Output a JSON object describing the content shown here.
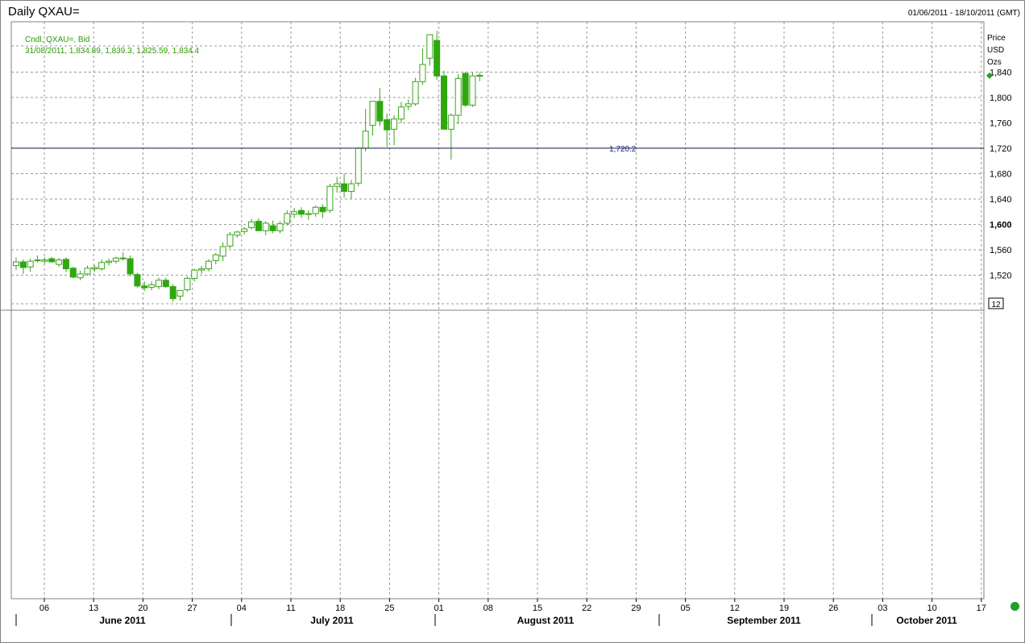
{
  "header": {
    "title": "Daily QXAU=",
    "date_range": "01/06/2011 - 18/10/2011 (GMT)"
  },
  "legend": {
    "line1": "Cndl, QXAU=, Bid",
    "line2": "31/08/2011, 1,834.89, 1,839.3, 1,825.59, 1,834.4"
  },
  "axis_unit": [
    "Price",
    "USD",
    "Ozs"
  ],
  "colors": {
    "up_candle_border": "#3aa31a",
    "down_candle_fill": "#2fa80f",
    "grid": "#9a9a9a",
    "reference_line": "#1a1a55",
    "reference_label": "#1a1a88"
  },
  "chart_data": {
    "type": "candlestick",
    "title": "Daily QXAU=",
    "ylabel": "Price USD Ozs",
    "ylim": [
      1495,
      1905
    ],
    "y_ticks": [
      "1,520",
      "1,560",
      "1,600",
      "1,640",
      "1,680",
      "1,720",
      "1,760",
      "1,800",
      "1,840"
    ],
    "y_tick_values": [
      1520,
      1560,
      1600,
      1640,
      1680,
      1720,
      1760,
      1800,
      1840
    ],
    "x_ticks": [
      "06",
      "13",
      "20",
      "27",
      "04",
      "11",
      "18",
      "25",
      "01",
      "08",
      "15",
      "22",
      "29",
      "05",
      "12",
      "19",
      "26",
      "03",
      "10",
      "17"
    ],
    "months": [
      "June 2011",
      "July 2011",
      "August 2011",
      "September 2011",
      "October 2011"
    ],
    "reference_line": {
      "value": 1720.2,
      "label": "1,720.2"
    },
    "last_price_marker": 1834.4,
    "sub_panel_label": "12",
    "candles": [
      {
        "date": "2011-06-01",
        "o": 1535,
        "h": 1548,
        "l": 1528,
        "c": 1541
      },
      {
        "date": "2011-06-02",
        "o": 1541,
        "h": 1545,
        "l": 1522,
        "c": 1532
      },
      {
        "date": "2011-06-03",
        "o": 1533,
        "h": 1546,
        "l": 1525,
        "c": 1542
      },
      {
        "date": "2011-06-06",
        "o": 1544,
        "h": 1551,
        "l": 1540,
        "c": 1543
      },
      {
        "date": "2011-06-07",
        "o": 1542,
        "h": 1548,
        "l": 1538,
        "c": 1544
      },
      {
        "date": "2011-06-08",
        "o": 1546,
        "h": 1549,
        "l": 1540,
        "c": 1541
      },
      {
        "date": "2011-06-09",
        "o": 1537,
        "h": 1547,
        "l": 1533,
        "c": 1544
      },
      {
        "date": "2011-06-10",
        "o": 1545,
        "h": 1548,
        "l": 1525,
        "c": 1530
      },
      {
        "date": "2011-06-13",
        "o": 1531,
        "h": 1533,
        "l": 1515,
        "c": 1517
      },
      {
        "date": "2011-06-14",
        "o": 1516,
        "h": 1527,
        "l": 1512,
        "c": 1522
      },
      {
        "date": "2011-06-15",
        "o": 1522,
        "h": 1535,
        "l": 1519,
        "c": 1531
      },
      {
        "date": "2011-06-16",
        "o": 1530,
        "h": 1536,
        "l": 1525,
        "c": 1532
      },
      {
        "date": "2011-06-17",
        "o": 1530,
        "h": 1545,
        "l": 1527,
        "c": 1540
      },
      {
        "date": "2011-06-20",
        "o": 1540,
        "h": 1546,
        "l": 1535,
        "c": 1542
      },
      {
        "date": "2011-06-21",
        "o": 1542,
        "h": 1549,
        "l": 1538,
        "c": 1547
      },
      {
        "date": "2011-06-22",
        "o": 1547,
        "h": 1556,
        "l": 1543,
        "c": 1547
      },
      {
        "date": "2011-06-23",
        "o": 1546,
        "h": 1551,
        "l": 1518,
        "c": 1522
      },
      {
        "date": "2011-06-24",
        "o": 1521,
        "h": 1524,
        "l": 1500,
        "c": 1503
      },
      {
        "date": "2011-06-27",
        "o": 1503,
        "h": 1510,
        "l": 1495,
        "c": 1500
      },
      {
        "date": "2011-06-28",
        "o": 1501,
        "h": 1510,
        "l": 1496,
        "c": 1505
      },
      {
        "date": "2011-06-29",
        "o": 1502,
        "h": 1516,
        "l": 1498,
        "c": 1512
      },
      {
        "date": "2011-06-30",
        "o": 1512,
        "h": 1516,
        "l": 1500,
        "c": 1502
      },
      {
        "date": "2011-07-01",
        "o": 1502,
        "h": 1506,
        "l": 1478,
        "c": 1483
      },
      {
        "date": "2011-07-04",
        "o": 1487,
        "h": 1496,
        "l": 1480,
        "c": 1496
      },
      {
        "date": "2011-07-05",
        "o": 1497,
        "h": 1518,
        "l": 1494,
        "c": 1515
      },
      {
        "date": "2011-07-06",
        "o": 1515,
        "h": 1530,
        "l": 1510,
        "c": 1528
      },
      {
        "date": "2011-07-07",
        "o": 1528,
        "h": 1535,
        "l": 1522,
        "c": 1530
      },
      {
        "date": "2011-07-08",
        "o": 1530,
        "h": 1545,
        "l": 1526,
        "c": 1542
      },
      {
        "date": "2011-07-11",
        "o": 1543,
        "h": 1555,
        "l": 1537,
        "c": 1552
      },
      {
        "date": "2011-07-12",
        "o": 1550,
        "h": 1572,
        "l": 1542,
        "c": 1565
      },
      {
        "date": "2011-07-13",
        "o": 1566,
        "h": 1588,
        "l": 1562,
        "c": 1584
      },
      {
        "date": "2011-07-14",
        "o": 1583,
        "h": 1590,
        "l": 1579,
        "c": 1588
      },
      {
        "date": "2011-07-15",
        "o": 1589,
        "h": 1596,
        "l": 1584,
        "c": 1593
      },
      {
        "date": "2011-07-18",
        "o": 1595,
        "h": 1609,
        "l": 1592,
        "c": 1604
      },
      {
        "date": "2011-07-19",
        "o": 1605,
        "h": 1610,
        "l": 1590,
        "c": 1590
      },
      {
        "date": "2011-07-20",
        "o": 1590,
        "h": 1605,
        "l": 1583,
        "c": 1602
      },
      {
        "date": "2011-07-21",
        "o": 1598,
        "h": 1606,
        "l": 1586,
        "c": 1590
      },
      {
        "date": "2011-07-22",
        "o": 1590,
        "h": 1605,
        "l": 1586,
        "c": 1601
      },
      {
        "date": "2011-07-25",
        "o": 1602,
        "h": 1622,
        "l": 1598,
        "c": 1617
      },
      {
        "date": "2011-07-26",
        "o": 1616,
        "h": 1626,
        "l": 1610,
        "c": 1620
      },
      {
        "date": "2011-07-27",
        "o": 1622,
        "h": 1627,
        "l": 1610,
        "c": 1616
      },
      {
        "date": "2011-07-28",
        "o": 1616,
        "h": 1622,
        "l": 1607,
        "c": 1617
      },
      {
        "date": "2011-07-29",
        "o": 1617,
        "h": 1630,
        "l": 1612,
        "c": 1627
      },
      {
        "date": "2011-08-01",
        "o": 1627,
        "h": 1632,
        "l": 1610,
        "c": 1620
      },
      {
        "date": "2011-08-02",
        "o": 1622,
        "h": 1664,
        "l": 1618,
        "c": 1660
      },
      {
        "date": "2011-08-03",
        "o": 1660,
        "h": 1675,
        "l": 1650,
        "c": 1664
      },
      {
        "date": "2011-08-04",
        "o": 1664,
        "h": 1680,
        "l": 1642,
        "c": 1652
      },
      {
        "date": "2011-08-05",
        "o": 1652,
        "h": 1670,
        "l": 1640,
        "c": 1664
      },
      {
        "date": "2011-08-08",
        "o": 1665,
        "h": 1722,
        "l": 1660,
        "c": 1720
      },
      {
        "date": "2011-08-09",
        "o": 1720,
        "h": 1782,
        "l": 1715,
        "c": 1747
      },
      {
        "date": "2011-08-10",
        "o": 1756,
        "h": 1794,
        "l": 1740,
        "c": 1794
      },
      {
        "date": "2011-08-11",
        "o": 1794,
        "h": 1815,
        "l": 1755,
        "c": 1763
      },
      {
        "date": "2011-08-12",
        "o": 1765,
        "h": 1775,
        "l": 1722,
        "c": 1749
      },
      {
        "date": "2011-08-15",
        "o": 1750,
        "h": 1772,
        "l": 1725,
        "c": 1766
      },
      {
        "date": "2011-08-16",
        "o": 1766,
        "h": 1793,
        "l": 1760,
        "c": 1785
      },
      {
        "date": "2011-08-17",
        "o": 1786,
        "h": 1797,
        "l": 1780,
        "c": 1790
      },
      {
        "date": "2011-08-18",
        "o": 1790,
        "h": 1831,
        "l": 1787,
        "c": 1825
      },
      {
        "date": "2011-08-19",
        "o": 1825,
        "h": 1877,
        "l": 1820,
        "c": 1852
      },
      {
        "date": "2011-08-22",
        "o": 1862,
        "h": 1900,
        "l": 1850,
        "c": 1899
      },
      {
        "date": "2011-08-23",
        "o": 1890,
        "h": 1905,
        "l": 1828,
        "c": 1834
      },
      {
        "date": "2011-08-24",
        "o": 1834,
        "h": 1842,
        "l": 1755,
        "c": 1750
      },
      {
        "date": "2011-08-25",
        "o": 1750,
        "h": 1775,
        "l": 1702,
        "c": 1772
      },
      {
        "date": "2011-08-26",
        "o": 1772,
        "h": 1837,
        "l": 1758,
        "c": 1830
      },
      {
        "date": "2011-08-29",
        "o": 1838,
        "h": 1840,
        "l": 1785,
        "c": 1788
      },
      {
        "date": "2011-08-30",
        "o": 1788,
        "h": 1840,
        "l": 1785,
        "c": 1834
      },
      {
        "date": "2011-08-31",
        "o": 1834.89,
        "h": 1839.3,
        "l": 1825.59,
        "c": 1834.4
      }
    ]
  }
}
